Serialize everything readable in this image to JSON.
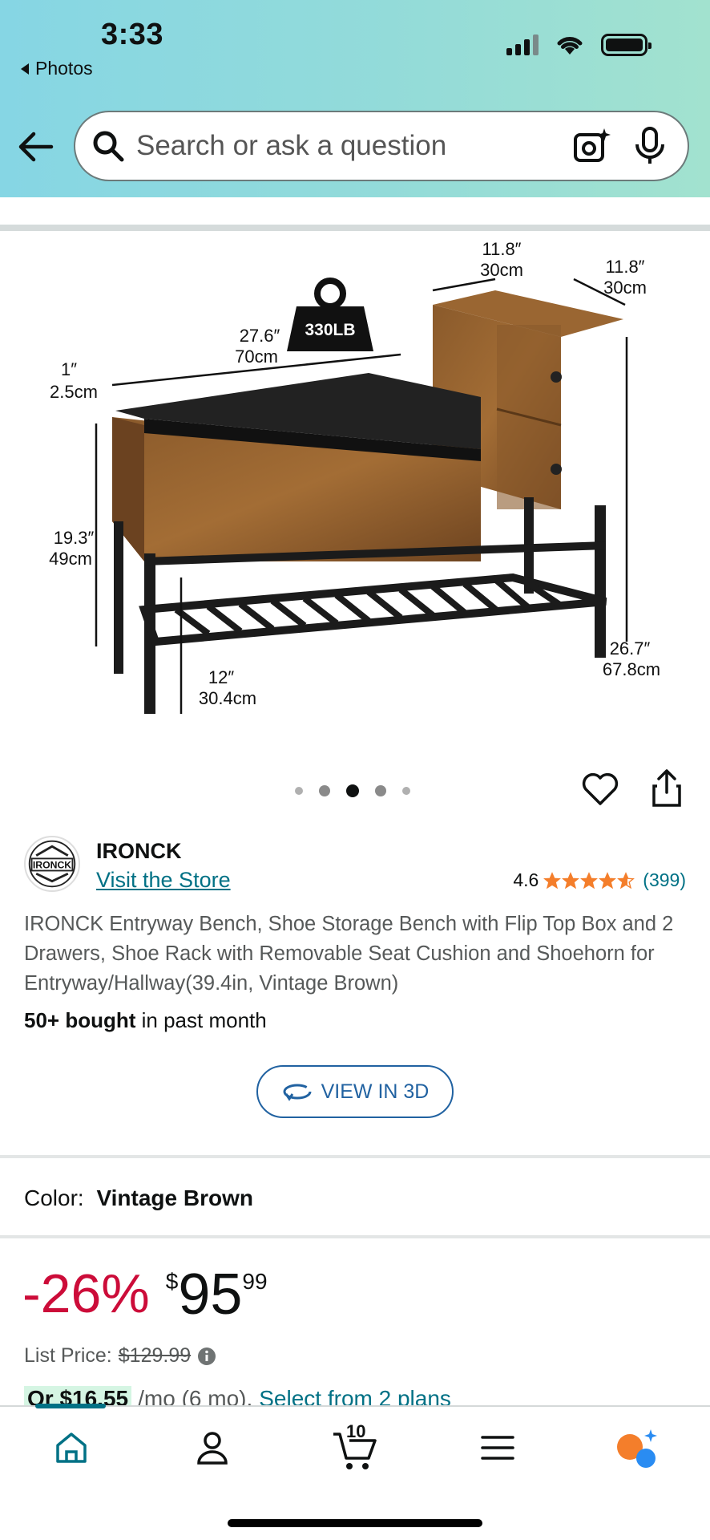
{
  "status_bar": {
    "time": "3:33",
    "back_app": "Photos"
  },
  "search": {
    "placeholder": "Search or ask a question"
  },
  "product_image": {
    "load_label": "330LB",
    "dims": {
      "top_width": [
        "11.8″",
        "30cm"
      ],
      "right_depth": [
        "11.8″",
        "30cm"
      ],
      "bench_width": [
        "27.6″",
        "70cm"
      ],
      "cushion_thickness": [
        "1″",
        "2.5cm"
      ],
      "seat_height": [
        "19.3″",
        "49cm"
      ],
      "shelf_height": [
        "12″",
        "30.4cm"
      ],
      "total_height": [
        "26.7″",
        "67.8cm"
      ]
    }
  },
  "carousel": {
    "count": 5,
    "active": 3
  },
  "brand": {
    "logo_text": "IRONCK",
    "name": "IRONCK",
    "visit_store": "Visit the Store",
    "rating": "4.6",
    "stars": 4.6,
    "review_count": "(399)"
  },
  "product": {
    "title": "IRONCK Entryway Bench, Shoe Storage Bench with Flip Top Box and 2 Drawers, Shoe Rack with Removable Seat Cushion and Shoehorn for Entryway/Hallway(39.4in, Vintage Brown)",
    "bought_bold": "50+ bought",
    "bought_rest": "in past month",
    "view_3d": "VIEW IN 3D"
  },
  "color": {
    "label": "Color:",
    "value": "Vintage Brown"
  },
  "pricing": {
    "discount": "-26%",
    "currency": "$",
    "whole": "95",
    "fraction": "99",
    "list_label": "List Price:",
    "list_price": "$129.99",
    "installment_prefix": "Or",
    "installment_amount": "$16.55",
    "installment_term": "/mo (6 mo).",
    "installment_link": "Select from 2 plans"
  },
  "bottom_nav": {
    "cart_count": "10"
  },
  "colors": {
    "link": "#007185",
    "deal_red": "#cc0c39",
    "star_orange": "#f47e2b",
    "button_blue": "#2162a1"
  }
}
